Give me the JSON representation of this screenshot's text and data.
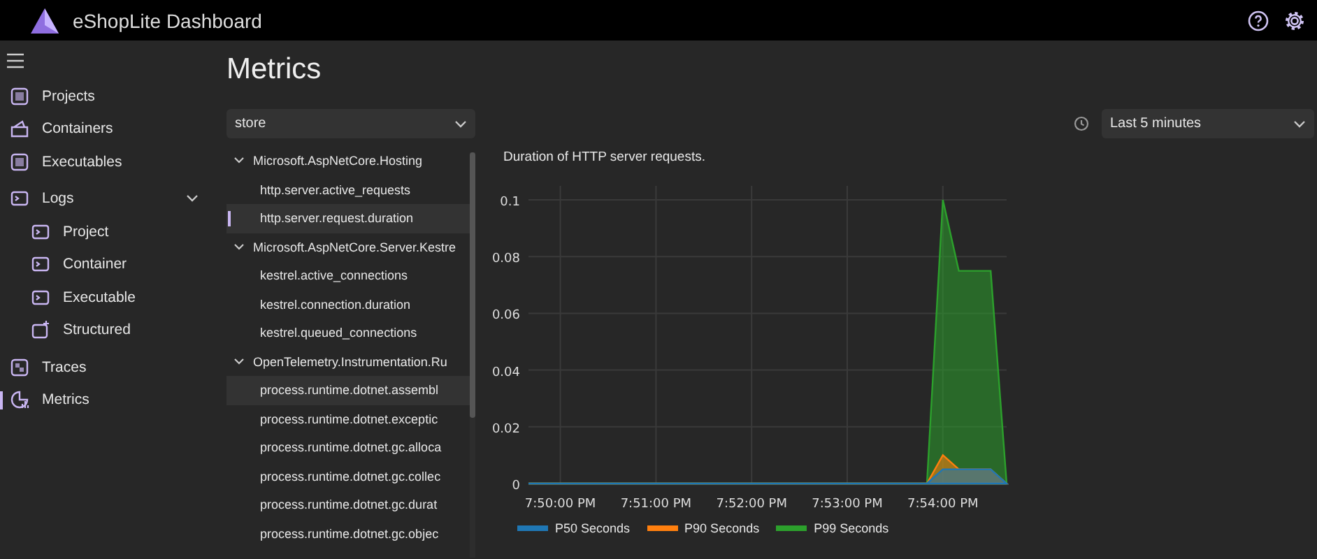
{
  "header": {
    "title": "eShopLite Dashboard"
  },
  "sidebar": {
    "items": [
      {
        "label": "Projects",
        "kind": "projects",
        "selected": false
      },
      {
        "label": "Containers",
        "kind": "containers",
        "selected": false
      },
      {
        "label": "Executables",
        "kind": "projects",
        "selected": false
      },
      {
        "label": "Logs",
        "kind": "logs",
        "selected": false,
        "expanded": true,
        "children": [
          {
            "label": "Project",
            "kind": "logs",
            "selected": false
          },
          {
            "label": "Container",
            "kind": "logs",
            "selected": false
          },
          {
            "label": "Executable",
            "kind": "logs",
            "selected": false
          },
          {
            "label": "Structured",
            "kind": "structured",
            "selected": false
          }
        ]
      },
      {
        "label": "Traces",
        "kind": "traces",
        "selected": false
      },
      {
        "label": "Metrics",
        "kind": "metrics",
        "selected": true
      }
    ]
  },
  "page_title": "Metrics",
  "resource_select": {
    "value": "store"
  },
  "time_select": {
    "value": "Last 5 minutes"
  },
  "tree": [
    {
      "label": "Microsoft.AspNetCore.Hosting",
      "expanded": true,
      "children": [
        {
          "label": "http.server.active_requests",
          "selected": false
        },
        {
          "label": "http.server.request.duration",
          "selected": true
        }
      ]
    },
    {
      "label": "Microsoft.AspNetCore.Server.Kestre",
      "expanded": true,
      "children": [
        {
          "label": "kestrel.active_connections",
          "selected": false
        },
        {
          "label": "kestrel.connection.duration",
          "selected": false
        },
        {
          "label": "kestrel.queued_connections",
          "selected": false
        }
      ]
    },
    {
      "label": "OpenTelemetry.Instrumentation.Ru",
      "expanded": true,
      "children": [
        {
          "label": "process.runtime.dotnet.assembl",
          "selected": false,
          "hover": true
        },
        {
          "label": "process.runtime.dotnet.exceptic",
          "selected": false
        },
        {
          "label": "process.runtime.dotnet.gc.alloca",
          "selected": false
        },
        {
          "label": "process.runtime.dotnet.gc.collec",
          "selected": false
        },
        {
          "label": "process.runtime.dotnet.gc.durat",
          "selected": false
        },
        {
          "label": "process.runtime.dotnet.gc.objec",
          "selected": false
        }
      ]
    }
  ],
  "chart": {
    "description": "Duration of HTTP server requests.",
    "chart_data": {
      "type": "area",
      "grid": true,
      "categories": [
        null,
        null,
        "7:50:00 PM",
        null,
        null,
        null,
        null,
        null,
        "7:51:00 PM",
        null,
        null,
        null,
        null,
        null,
        "7:52:00 PM",
        null,
        null,
        null,
        null,
        null,
        "7:53:00 PM",
        null,
        null,
        null,
        null,
        null,
        "7:54:00 PM",
        null,
        null,
        null,
        null
      ],
      "ylim": [
        0,
        0.1
      ],
      "yticks": [
        0,
        0.02,
        0.04,
        0.06,
        0.08,
        0.1
      ],
      "series": [
        {
          "name": "P99 Seconds",
          "color": "#2ca02c",
          "values": [
            0,
            0,
            0,
            0,
            0,
            0,
            0,
            0,
            0,
            0,
            0,
            0,
            0,
            0,
            0,
            0,
            0,
            0,
            0,
            0,
            0,
            0,
            0,
            0,
            0,
            0,
            0.1,
            0.075,
            0.075,
            0.075,
            0
          ]
        },
        {
          "name": "P90 Seconds",
          "color": "#ff7f0e",
          "values": [
            0,
            0,
            0,
            0,
            0,
            0,
            0,
            0,
            0,
            0,
            0,
            0,
            0,
            0,
            0,
            0,
            0,
            0,
            0,
            0,
            0,
            0,
            0,
            0,
            0,
            0,
            0.01,
            0.005,
            0.005,
            0.005,
            0
          ]
        },
        {
          "name": "P50 Seconds",
          "color": "#1f77b4",
          "values": [
            0,
            0,
            0,
            0,
            0,
            0,
            0,
            0,
            0,
            0,
            0,
            0,
            0,
            0,
            0,
            0,
            0,
            0,
            0,
            0,
            0,
            0,
            0,
            0,
            0,
            0,
            0.005,
            0.005,
            0.005,
            0.005,
            0
          ]
        }
      ]
    }
  }
}
